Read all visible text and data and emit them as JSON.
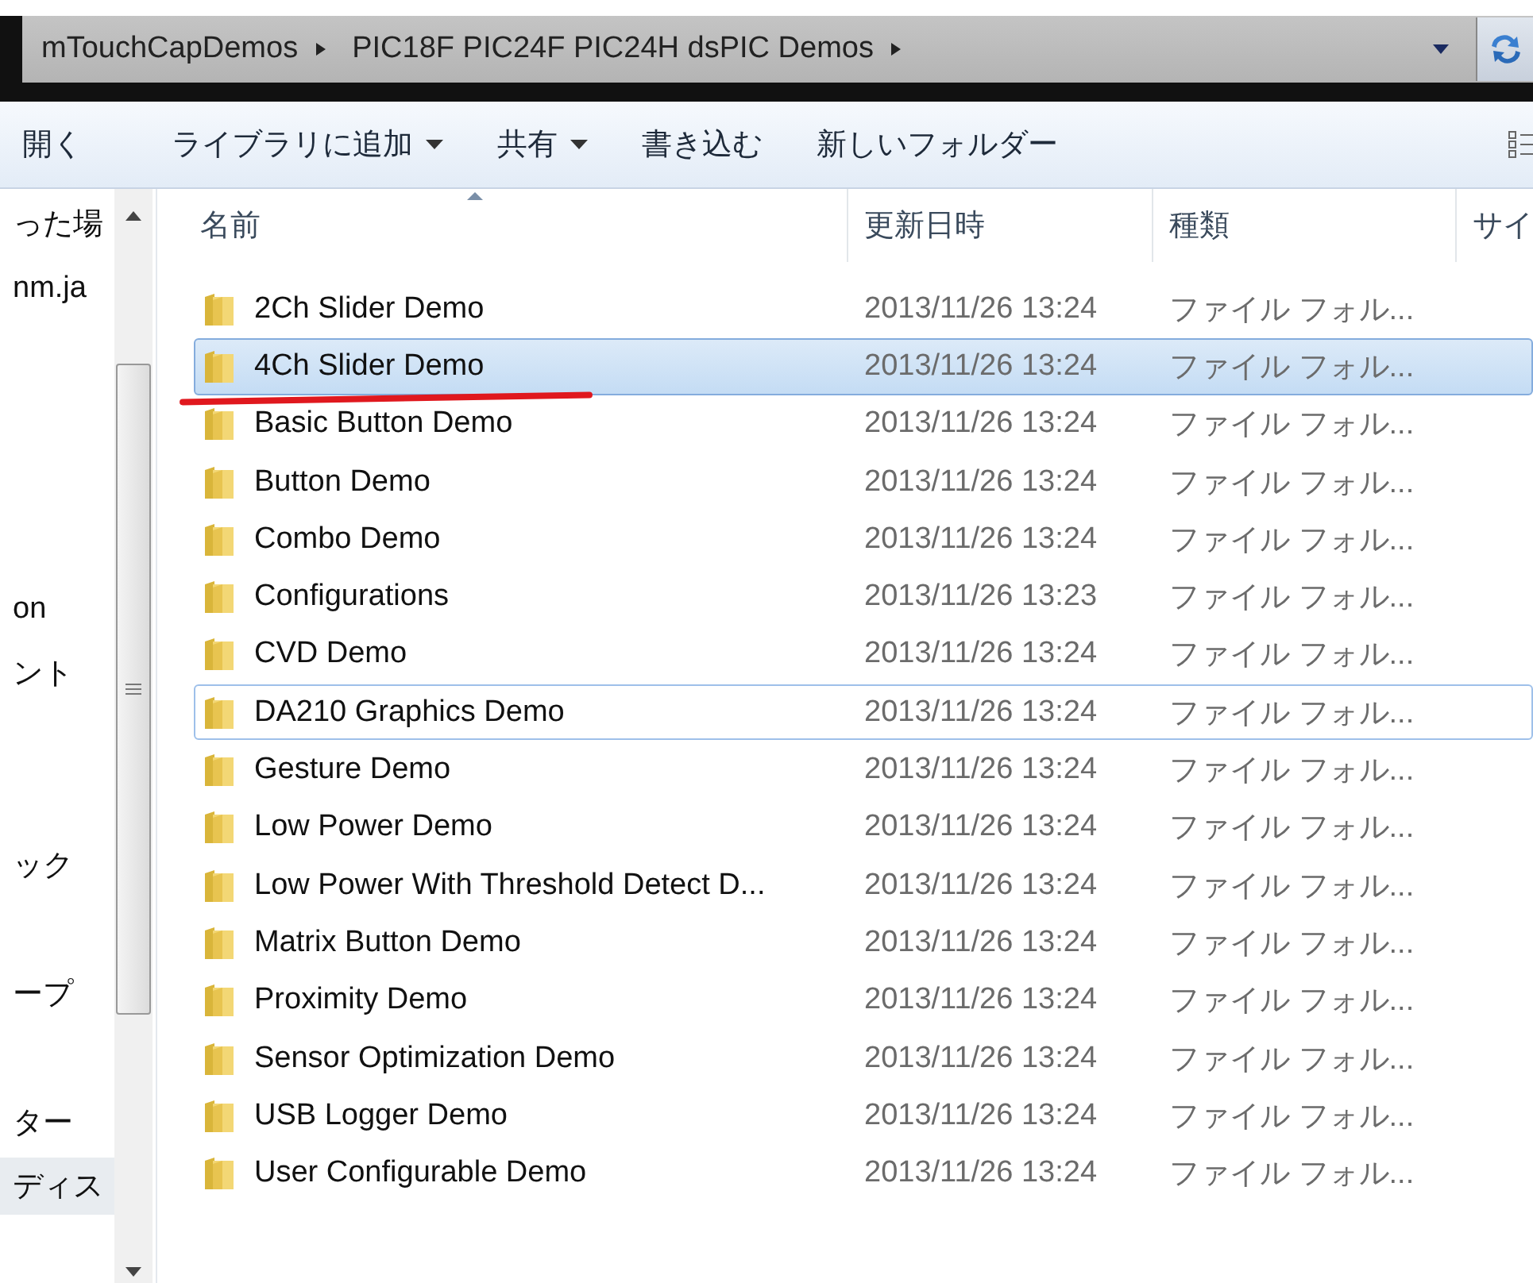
{
  "address_bar": {
    "crumbs": [
      "mTouchCapDemos",
      "PIC18F PIC24F PIC24H dsPIC Demos"
    ]
  },
  "toolbar": {
    "buttons": [
      {
        "label": "開く",
        "dropdown": false
      },
      {
        "label": "ライブラリに追加",
        "dropdown": true
      },
      {
        "label": "共有",
        "dropdown": true
      },
      {
        "label": "書き込む",
        "dropdown": false
      },
      {
        "label": "新しいフォルダー",
        "dropdown": false
      }
    ]
  },
  "nav_pane": {
    "items": [
      {
        "label": "った場",
        "selected": false
      },
      {
        "label": "nm.ja",
        "selected": false
      },
      {
        "label": "on",
        "selected": false
      },
      {
        "label": "ント",
        "selected": false
      },
      {
        "label": "ック",
        "selected": false
      },
      {
        "label": "ープ",
        "selected": false
      },
      {
        "label": "ター",
        "selected": false
      },
      {
        "label": "ディス",
        "selected": true
      }
    ]
  },
  "table": {
    "columns": [
      "名前",
      "更新日時",
      "種類",
      "サイ"
    ],
    "rows": [
      {
        "name": "2Ch Slider Demo",
        "date": "2013/11/26 13:24",
        "type": "ファイル フォル...",
        "selected": false,
        "focused": false,
        "underlined": false
      },
      {
        "name": "4Ch Slider Demo",
        "date": "2013/11/26 13:24",
        "type": "ファイル フォル...",
        "selected": true,
        "focused": false,
        "underlined": true
      },
      {
        "name": "Basic Button Demo",
        "date": "2013/11/26 13:24",
        "type": "ファイル フォル...",
        "selected": false,
        "focused": false,
        "underlined": false
      },
      {
        "name": "Button Demo",
        "date": "2013/11/26 13:24",
        "type": "ファイル フォル...",
        "selected": false,
        "focused": false,
        "underlined": false
      },
      {
        "name": "Combo Demo",
        "date": "2013/11/26 13:24",
        "type": "ファイル フォル...",
        "selected": false,
        "focused": false,
        "underlined": false
      },
      {
        "name": "Configurations",
        "date": "2013/11/26 13:23",
        "type": "ファイル フォル...",
        "selected": false,
        "focused": false,
        "underlined": false
      },
      {
        "name": "CVD Demo",
        "date": "2013/11/26 13:24",
        "type": "ファイル フォル...",
        "selected": false,
        "focused": false,
        "underlined": false
      },
      {
        "name": "DA210 Graphics Demo",
        "date": "2013/11/26 13:24",
        "type": "ファイル フォル...",
        "selected": false,
        "focused": true,
        "underlined": false
      },
      {
        "name": "Gesture Demo",
        "date": "2013/11/26 13:24",
        "type": "ファイル フォル...",
        "selected": false,
        "focused": false,
        "underlined": false
      },
      {
        "name": "Low Power Demo",
        "date": "2013/11/26 13:24",
        "type": "ファイル フォル...",
        "selected": false,
        "focused": false,
        "underlined": false
      },
      {
        "name": "Low Power With Threshold Detect D...",
        "date": "2013/11/26 13:24",
        "type": "ファイル フォル...",
        "selected": false,
        "focused": false,
        "underlined": false
      },
      {
        "name": "Matrix Button Demo",
        "date": "2013/11/26 13:24",
        "type": "ファイル フォル...",
        "selected": false,
        "focused": false,
        "underlined": false
      },
      {
        "name": "Proximity Demo",
        "date": "2013/11/26 13:24",
        "type": "ファイル フォル...",
        "selected": false,
        "focused": false,
        "underlined": false
      },
      {
        "name": "Sensor Optimization Demo",
        "date": "2013/11/26 13:24",
        "type": "ファイル フォル...",
        "selected": false,
        "focused": false,
        "underlined": false
      },
      {
        "name": "USB Logger Demo",
        "date": "2013/11/26 13:24",
        "type": "ファイル フォル...",
        "selected": false,
        "focused": false,
        "underlined": false
      },
      {
        "name": "User Configurable Demo",
        "date": "2013/11/26 13:24",
        "type": "ファイル フォル...",
        "selected": false,
        "focused": false,
        "underlined": false
      }
    ]
  }
}
